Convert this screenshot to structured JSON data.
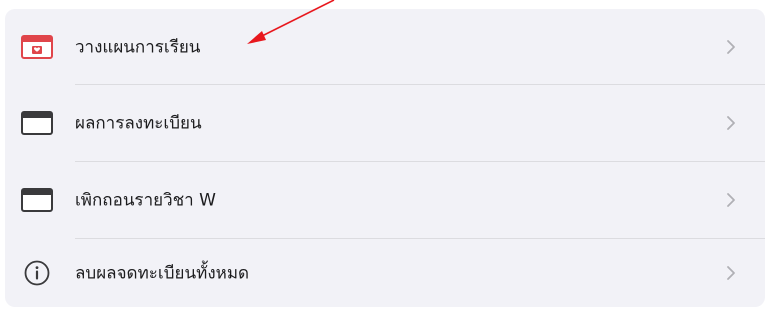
{
  "menu": {
    "items": [
      {
        "label": "วางแผนการเรียน",
        "icon": "calendar-heart-icon"
      },
      {
        "label": "ผลการลงทะเบียน",
        "icon": "calendar-icon"
      },
      {
        "label": "เพิกถอนรายวิชา W",
        "icon": "calendar-icon"
      },
      {
        "label": "ลบผลจดทะเบียนทั้งหมด",
        "icon": "info-circle-icon"
      }
    ]
  },
  "colors": {
    "card_background": "#f2f2f7",
    "separator": "#dcdce0",
    "text": "#1c1c1e",
    "chevron": "#b0b0b5",
    "icon_dark": "#3a3a3c",
    "icon_accent": "#e0454a",
    "annotation_arrow": "#e8181e"
  },
  "annotation": {
    "type": "arrow",
    "target": "วางแผนการเรียน"
  }
}
